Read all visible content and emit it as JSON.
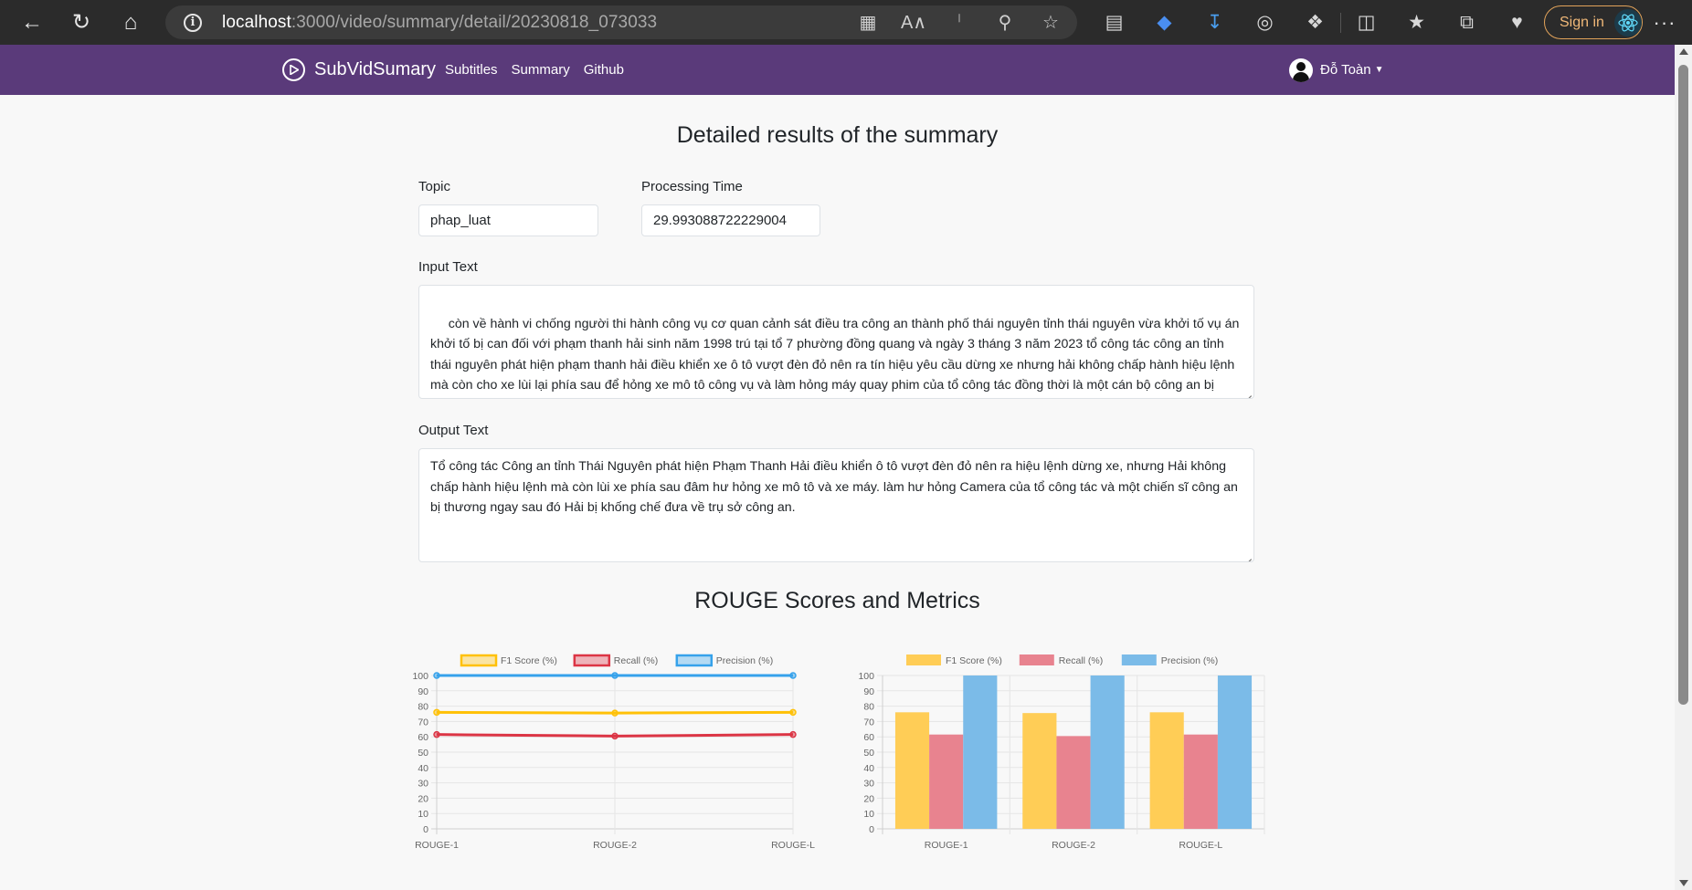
{
  "browser": {
    "url_host": "localhost",
    "url_path": ":3000/video/summary/detail/20230818_073033",
    "signin_label": "Sign in"
  },
  "navbar": {
    "brand": "SubVidSumary",
    "links": [
      "Subtitles",
      "Summary",
      "Github"
    ],
    "user": "Đỗ Toàn"
  },
  "page": {
    "title": "Detailed results of the summary",
    "topic_label": "Topic",
    "topic_value": "phap_luat",
    "time_label": "Processing Time",
    "time_value": "29.993088722229004",
    "input_label": "Input Text",
    "input_text": " còn về hành vi chống người thi hành công vụ cơ quan cảnh sát điều tra công an thành phố thái nguyên tỉnh thái nguyên vừa khởi tố vụ án khởi tố bị can đối với phạm thanh hải sinh năm 1998 trú tại tổ 7 phường đồng quang và ngày 3 tháng 3 năm 2023 tổ công tác công an tỉnh thái nguyên phát hiện phạm thanh hải điều khiển xe ô tô vượt đèn đỏ nên ra tín hiệu yêu cầu dừng xe nhưng hải không chấp hành hiệu lệnh mà còn cho xe lùi lại phía sau để hỏng xe mô tô công vụ và làm hỏng máy quay phim của tổ công tác đồng thời là một cán bộ công an bị thương ngay sau đó hải bị khống chế và đưa về cơ quan công an",
    "output_label": "Output Text",
    "output_text": "Tổ công tác Công an tỉnh Thái Nguyên phát hiện Phạm Thanh Hải điều khiển ô tô vượt đèn đỏ nên ra hiệu lệnh dừng xe, nhưng Hải không chấp hành hiệu lệnh mà còn lùi xe phía sau đâm hư hỏng xe mô tô và xe máy. làm hư hỏng Camera của tổ công tác và một chiến sĩ công an bị thương ngay sau đó Hải bị khống chế đưa về trụ sở công an.",
    "metrics_title": "ROUGE Scores and Metrics"
  },
  "chart_data": [
    {
      "type": "line",
      "categories": [
        "ROUGE-1",
        "ROUGE-2",
        "ROUGE-L"
      ],
      "series": [
        {
          "name": "F1 Score (%)",
          "values": [
            76,
            75.5,
            76
          ],
          "color": "#ffc107"
        },
        {
          "name": "Recall (%)",
          "values": [
            61.5,
            60.5,
            61.5
          ],
          "color": "#dc3545"
        },
        {
          "name": "Precision (%)",
          "values": [
            100,
            100,
            100
          ],
          "color": "#36a2eb"
        }
      ],
      "ylim": [
        0,
        100
      ],
      "yticks": [
        0,
        10,
        20,
        30,
        40,
        50,
        60,
        70,
        80,
        90,
        100
      ],
      "legend": "top",
      "grid": true
    },
    {
      "type": "bar",
      "categories": [
        "ROUGE-1",
        "ROUGE-2",
        "ROUGE-L"
      ],
      "series": [
        {
          "name": "F1 Score (%)",
          "values": [
            76,
            75.5,
            76
          ],
          "color": "#ffcd56"
        },
        {
          "name": "Recall (%)",
          "values": [
            61.5,
            60.5,
            61.5
          ],
          "color": "#e8838f"
        },
        {
          "name": "Precision (%)",
          "values": [
            100,
            100,
            100
          ],
          "color": "#7bbbe8"
        }
      ],
      "ylim": [
        0,
        100
      ],
      "yticks": [
        0,
        10,
        20,
        30,
        40,
        50,
        60,
        70,
        80,
        90,
        100
      ],
      "legend": "top",
      "grid": true
    }
  ]
}
